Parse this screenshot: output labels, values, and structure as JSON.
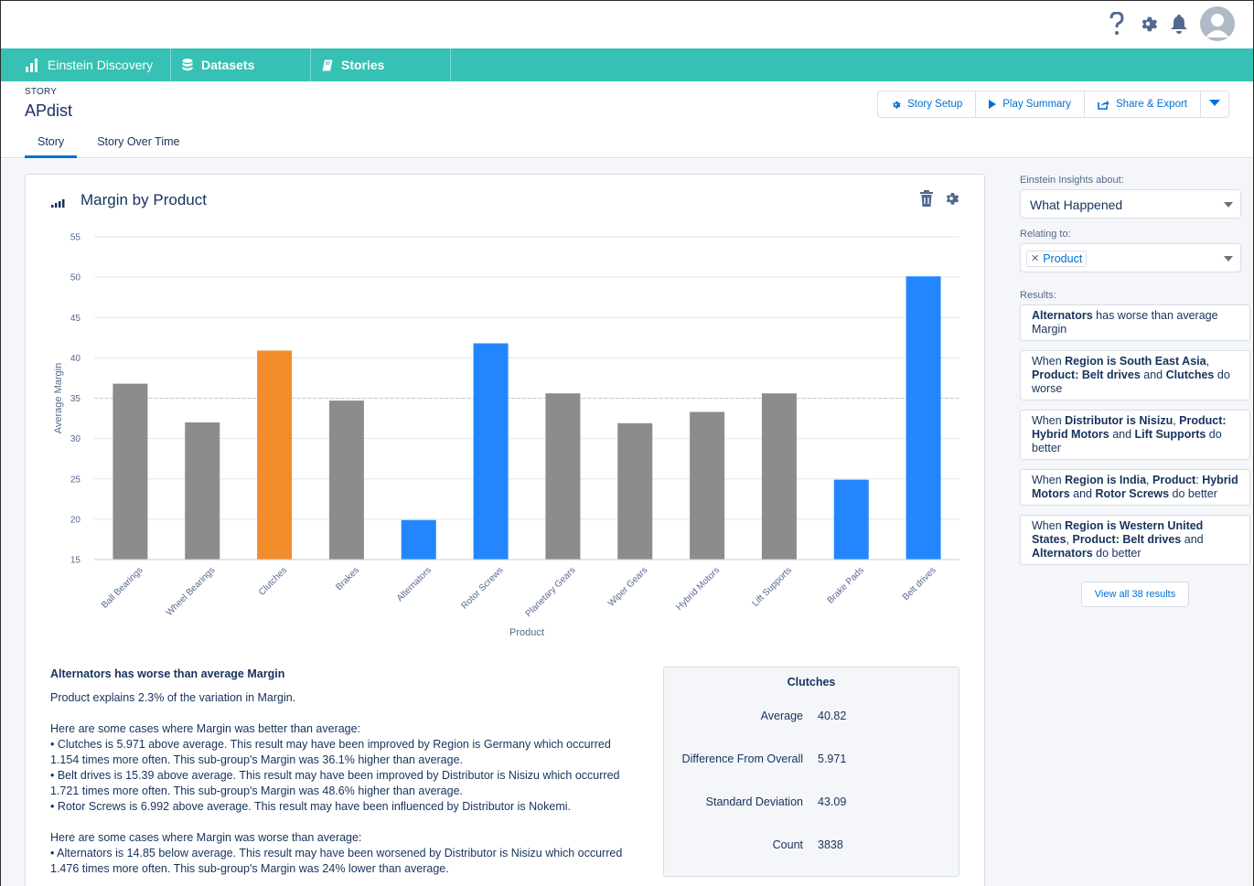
{
  "topbar": {
    "icons": [
      "help-icon",
      "gear-icon",
      "bell-icon",
      "avatar"
    ]
  },
  "nav": {
    "app": "Einstein Discovery",
    "items": [
      "Datasets",
      "Stories"
    ]
  },
  "header": {
    "eyebrow": "STORY",
    "title": "APdist",
    "tabs": [
      "Story",
      "Story Over Time"
    ],
    "buttons": {
      "setup": "Story Setup",
      "play": "Play Summary",
      "share": "Share & Export"
    }
  },
  "card": {
    "title": "Margin by Product"
  },
  "chart_data": {
    "type": "bar",
    "title": "Margin by Product",
    "xlabel": "Product",
    "ylabel": "Average Margin",
    "ylim": [
      15,
      55
    ],
    "yticks": [
      15,
      20,
      25,
      30,
      35,
      40,
      45,
      50,
      55
    ],
    "reference_line": 35,
    "grid": true,
    "categories": [
      "Ball Bearings",
      "Wheel Bearings",
      "Clutches",
      "Brakes",
      "Alternators",
      "Rotor Screws",
      "Planetary Gears",
      "Wiper Gears",
      "Hybrid Motors",
      "Lift Supports",
      "Brake Pads",
      "Belt drives"
    ],
    "values": [
      36.8,
      32.0,
      40.9,
      34.7,
      19.9,
      41.8,
      35.6,
      31.9,
      33.3,
      35.6,
      24.9,
      50.1
    ],
    "colors": [
      "#8c8c8c",
      "#8c8c8c",
      "#f38c2b",
      "#8c8c8c",
      "#2386ff",
      "#2386ff",
      "#8c8c8c",
      "#8c8c8c",
      "#8c8c8c",
      "#8c8c8c",
      "#2386ff",
      "#2386ff"
    ]
  },
  "insight": {
    "title": "Alternators has worse than average Margin",
    "explains": "Product explains 2.3% of the variation in Margin.",
    "better_intro": "Here are some cases where Margin was better than average:",
    "better": [
      "• Clutches is 5.971 above average. This result may have been improved by Region is Germany which occurred",
      "1.154 times more often. This sub-group's Margin was 36.1% higher than average.",
      "• Belt drives is 15.39 above average. This result may have been improved by Distributor is Nisizu which occurred",
      "1.721 times more often. This sub-group's Margin was 48.6% higher than average.",
      "• Rotor Screws is 6.992 above average. This result may have been influenced by Distributor is Nokemi."
    ],
    "worse_intro": "Here are some cases where Margin was worse than average:",
    "worse": [
      "• Alternators is 14.85 below average. This result may have been worsened by Distributor is Nisizu which occurred",
      "1.476 times more often. This sub-group's Margin was 24% lower than average."
    ]
  },
  "stats": {
    "title": "Clutches",
    "rows": [
      {
        "label": "Average",
        "value": "40.82"
      },
      {
        "label": "Difference From Overall",
        "value": "5.971"
      },
      {
        "label": "Standard Deviation",
        "value": "43.09"
      },
      {
        "label": "Count",
        "value": "3838"
      }
    ]
  },
  "side": {
    "insights_label": "Einstein Insights about:",
    "insights_value": "What Happened",
    "relating_label": "Relating to:",
    "relating_pill": "Product",
    "results_label": "Results:",
    "view_all": "View all 38 results"
  }
}
